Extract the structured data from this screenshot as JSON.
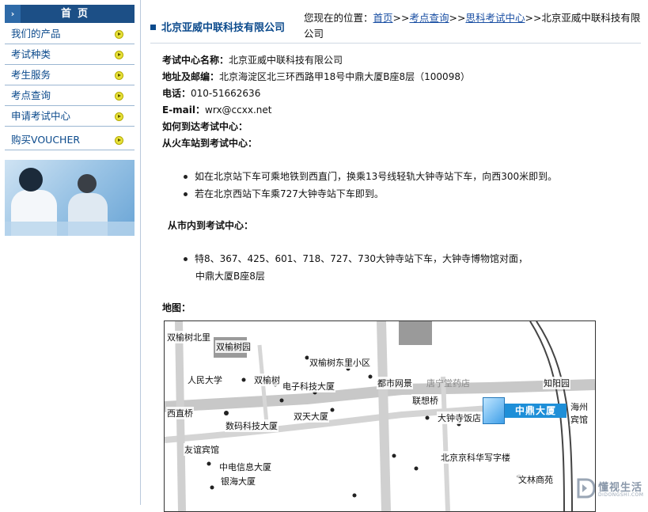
{
  "sidebar": {
    "header_arrow": "›",
    "header_label": "首页",
    "items": [
      {
        "label": "我们的产品"
      },
      {
        "label": "考试种类"
      },
      {
        "label": "考生服务"
      },
      {
        "label": "考点查询"
      },
      {
        "label": "申请考试中心"
      },
      {
        "label": "购买VOUCHER"
      }
    ]
  },
  "header": {
    "title": "北京亚威中联科技有限公司",
    "breadcrumb_prefix": "您现在的位置：",
    "crumbs": [
      "首页",
      "考点查询",
      "思科考试中心"
    ],
    "separator": ">>",
    "current": "北京亚威中联科技有限公司"
  },
  "details": {
    "center_name_label": "考试中心名称：",
    "center_name": "北京亚威中联科技有限公司",
    "address_label": "地址及邮编：",
    "address": "北京海淀区北三环西路甲18号中鼎大厦B座8层（100098）",
    "phone_label": "电话：",
    "phone": "010-51662636",
    "email_label": "E-mail：",
    "email": "wrx@ccxx.net",
    "howto_title": "如何到达考试中心：",
    "from_station_title": "从火车站到考试中心：",
    "from_station": [
      "如在北京站下车可乘地铁到西直门，换乘13号线轻轨大钟寺站下车，向西300米即到。",
      "若在北京西站下车乘727大钟寺站下车即到。"
    ],
    "from_city_title": "从市内到考试中心：",
    "from_city_line1": "特8、367、425、601、718、727、730大钟寺站下车，大钟寺博物馆对面，",
    "from_city_line2": "中鼎大厦B座8层",
    "map_label": "地图："
  },
  "map": {
    "labels": [
      "双榆树北里",
      "双榆树园",
      "双榆树东里小区",
      "人民大学",
      "双榆树",
      "电子科技大厦",
      "都市网景",
      "唐宁堂药店",
      "知阳园",
      "西直桥",
      "联想桥",
      "双天大厦",
      "数码科技大厦",
      "大钟寺饭店",
      "友谊宾馆",
      "中电信息大厦",
      "银海大厦",
      "北京京科华写字楼",
      "文林商苑",
      "海州",
      "宾馆"
    ],
    "building_badge": "中鼎大厦",
    "badge_color": "#1e8fd8"
  },
  "watermark": {
    "text": "懂视生活",
    "sub": "DIDONGSHI.COM"
  }
}
